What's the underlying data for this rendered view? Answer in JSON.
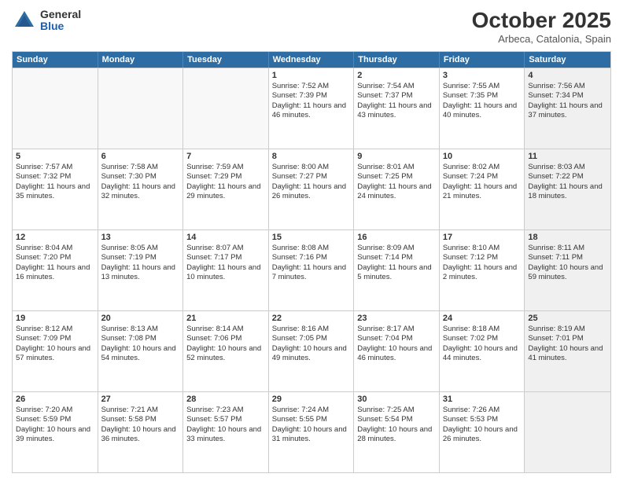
{
  "header": {
    "logo_general": "General",
    "logo_blue": "Blue",
    "month_title": "October 2025",
    "location": "Arbeca, Catalonia, Spain"
  },
  "days_of_week": [
    "Sunday",
    "Monday",
    "Tuesday",
    "Wednesday",
    "Thursday",
    "Friday",
    "Saturday"
  ],
  "rows": [
    [
      {
        "day": "",
        "empty": true
      },
      {
        "day": "",
        "empty": true
      },
      {
        "day": "",
        "empty": true
      },
      {
        "day": "1",
        "sunrise": "Sunrise: 7:52 AM",
        "sunset": "Sunset: 7:39 PM",
        "daylight": "Daylight: 11 hours and 46 minutes."
      },
      {
        "day": "2",
        "sunrise": "Sunrise: 7:54 AM",
        "sunset": "Sunset: 7:37 PM",
        "daylight": "Daylight: 11 hours and 43 minutes."
      },
      {
        "day": "3",
        "sunrise": "Sunrise: 7:55 AM",
        "sunset": "Sunset: 7:35 PM",
        "daylight": "Daylight: 11 hours and 40 minutes."
      },
      {
        "day": "4",
        "sunrise": "Sunrise: 7:56 AM",
        "sunset": "Sunset: 7:34 PM",
        "daylight": "Daylight: 11 hours and 37 minutes.",
        "shaded": true
      }
    ],
    [
      {
        "day": "5",
        "sunrise": "Sunrise: 7:57 AM",
        "sunset": "Sunset: 7:32 PM",
        "daylight": "Daylight: 11 hours and 35 minutes."
      },
      {
        "day": "6",
        "sunrise": "Sunrise: 7:58 AM",
        "sunset": "Sunset: 7:30 PM",
        "daylight": "Daylight: 11 hours and 32 minutes."
      },
      {
        "day": "7",
        "sunrise": "Sunrise: 7:59 AM",
        "sunset": "Sunset: 7:29 PM",
        "daylight": "Daylight: 11 hours and 29 minutes."
      },
      {
        "day": "8",
        "sunrise": "Sunrise: 8:00 AM",
        "sunset": "Sunset: 7:27 PM",
        "daylight": "Daylight: 11 hours and 26 minutes."
      },
      {
        "day": "9",
        "sunrise": "Sunrise: 8:01 AM",
        "sunset": "Sunset: 7:25 PM",
        "daylight": "Daylight: 11 hours and 24 minutes."
      },
      {
        "day": "10",
        "sunrise": "Sunrise: 8:02 AM",
        "sunset": "Sunset: 7:24 PM",
        "daylight": "Daylight: 11 hours and 21 minutes."
      },
      {
        "day": "11",
        "sunrise": "Sunrise: 8:03 AM",
        "sunset": "Sunset: 7:22 PM",
        "daylight": "Daylight: 11 hours and 18 minutes.",
        "shaded": true
      }
    ],
    [
      {
        "day": "12",
        "sunrise": "Sunrise: 8:04 AM",
        "sunset": "Sunset: 7:20 PM",
        "daylight": "Daylight: 11 hours and 16 minutes."
      },
      {
        "day": "13",
        "sunrise": "Sunrise: 8:05 AM",
        "sunset": "Sunset: 7:19 PM",
        "daylight": "Daylight: 11 hours and 13 minutes."
      },
      {
        "day": "14",
        "sunrise": "Sunrise: 8:07 AM",
        "sunset": "Sunset: 7:17 PM",
        "daylight": "Daylight: 11 hours and 10 minutes."
      },
      {
        "day": "15",
        "sunrise": "Sunrise: 8:08 AM",
        "sunset": "Sunset: 7:16 PM",
        "daylight": "Daylight: 11 hours and 7 minutes."
      },
      {
        "day": "16",
        "sunrise": "Sunrise: 8:09 AM",
        "sunset": "Sunset: 7:14 PM",
        "daylight": "Daylight: 11 hours and 5 minutes."
      },
      {
        "day": "17",
        "sunrise": "Sunrise: 8:10 AM",
        "sunset": "Sunset: 7:12 PM",
        "daylight": "Daylight: 11 hours and 2 minutes."
      },
      {
        "day": "18",
        "sunrise": "Sunrise: 8:11 AM",
        "sunset": "Sunset: 7:11 PM",
        "daylight": "Daylight: 10 hours and 59 minutes.",
        "shaded": true
      }
    ],
    [
      {
        "day": "19",
        "sunrise": "Sunrise: 8:12 AM",
        "sunset": "Sunset: 7:09 PM",
        "daylight": "Daylight: 10 hours and 57 minutes."
      },
      {
        "day": "20",
        "sunrise": "Sunrise: 8:13 AM",
        "sunset": "Sunset: 7:08 PM",
        "daylight": "Daylight: 10 hours and 54 minutes."
      },
      {
        "day": "21",
        "sunrise": "Sunrise: 8:14 AM",
        "sunset": "Sunset: 7:06 PM",
        "daylight": "Daylight: 10 hours and 52 minutes."
      },
      {
        "day": "22",
        "sunrise": "Sunrise: 8:16 AM",
        "sunset": "Sunset: 7:05 PM",
        "daylight": "Daylight: 10 hours and 49 minutes."
      },
      {
        "day": "23",
        "sunrise": "Sunrise: 8:17 AM",
        "sunset": "Sunset: 7:04 PM",
        "daylight": "Daylight: 10 hours and 46 minutes."
      },
      {
        "day": "24",
        "sunrise": "Sunrise: 8:18 AM",
        "sunset": "Sunset: 7:02 PM",
        "daylight": "Daylight: 10 hours and 44 minutes."
      },
      {
        "day": "25",
        "sunrise": "Sunrise: 8:19 AM",
        "sunset": "Sunset: 7:01 PM",
        "daylight": "Daylight: 10 hours and 41 minutes.",
        "shaded": true
      }
    ],
    [
      {
        "day": "26",
        "sunrise": "Sunrise: 7:20 AM",
        "sunset": "Sunset: 5:59 PM",
        "daylight": "Daylight: 10 hours and 39 minutes."
      },
      {
        "day": "27",
        "sunrise": "Sunrise: 7:21 AM",
        "sunset": "Sunset: 5:58 PM",
        "daylight": "Daylight: 10 hours and 36 minutes."
      },
      {
        "day": "28",
        "sunrise": "Sunrise: 7:23 AM",
        "sunset": "Sunset: 5:57 PM",
        "daylight": "Daylight: 10 hours and 33 minutes."
      },
      {
        "day": "29",
        "sunrise": "Sunrise: 7:24 AM",
        "sunset": "Sunset: 5:55 PM",
        "daylight": "Daylight: 10 hours and 31 minutes."
      },
      {
        "day": "30",
        "sunrise": "Sunrise: 7:25 AM",
        "sunset": "Sunset: 5:54 PM",
        "daylight": "Daylight: 10 hours and 28 minutes."
      },
      {
        "day": "31",
        "sunrise": "Sunrise: 7:26 AM",
        "sunset": "Sunset: 5:53 PM",
        "daylight": "Daylight: 10 hours and 26 minutes."
      },
      {
        "day": "",
        "empty": true,
        "shaded": true
      }
    ]
  ]
}
